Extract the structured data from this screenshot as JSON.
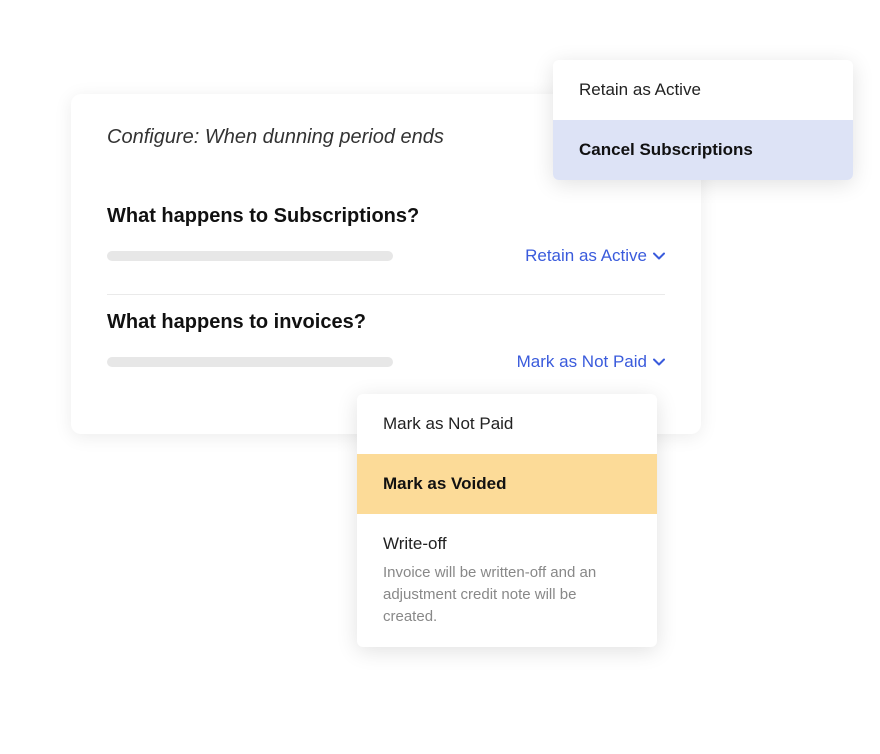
{
  "card": {
    "title": "Configure: When dunning period ends",
    "sections": [
      {
        "title": "What happens to Subscriptions?",
        "selected": "Retain as Active"
      },
      {
        "title": "What happens to invoices?",
        "selected": "Mark as Not Paid"
      }
    ]
  },
  "popover1": {
    "items": [
      {
        "label": "Retain as Active"
      },
      {
        "label": "Cancel Subscriptions"
      }
    ]
  },
  "popover2": {
    "items": [
      {
        "label": "Mark as Not Paid"
      },
      {
        "label": "Mark as Voided"
      },
      {
        "label": "Write-off",
        "desc": "Invoice will be written-off and an adjustment credit note will be created."
      }
    ]
  }
}
